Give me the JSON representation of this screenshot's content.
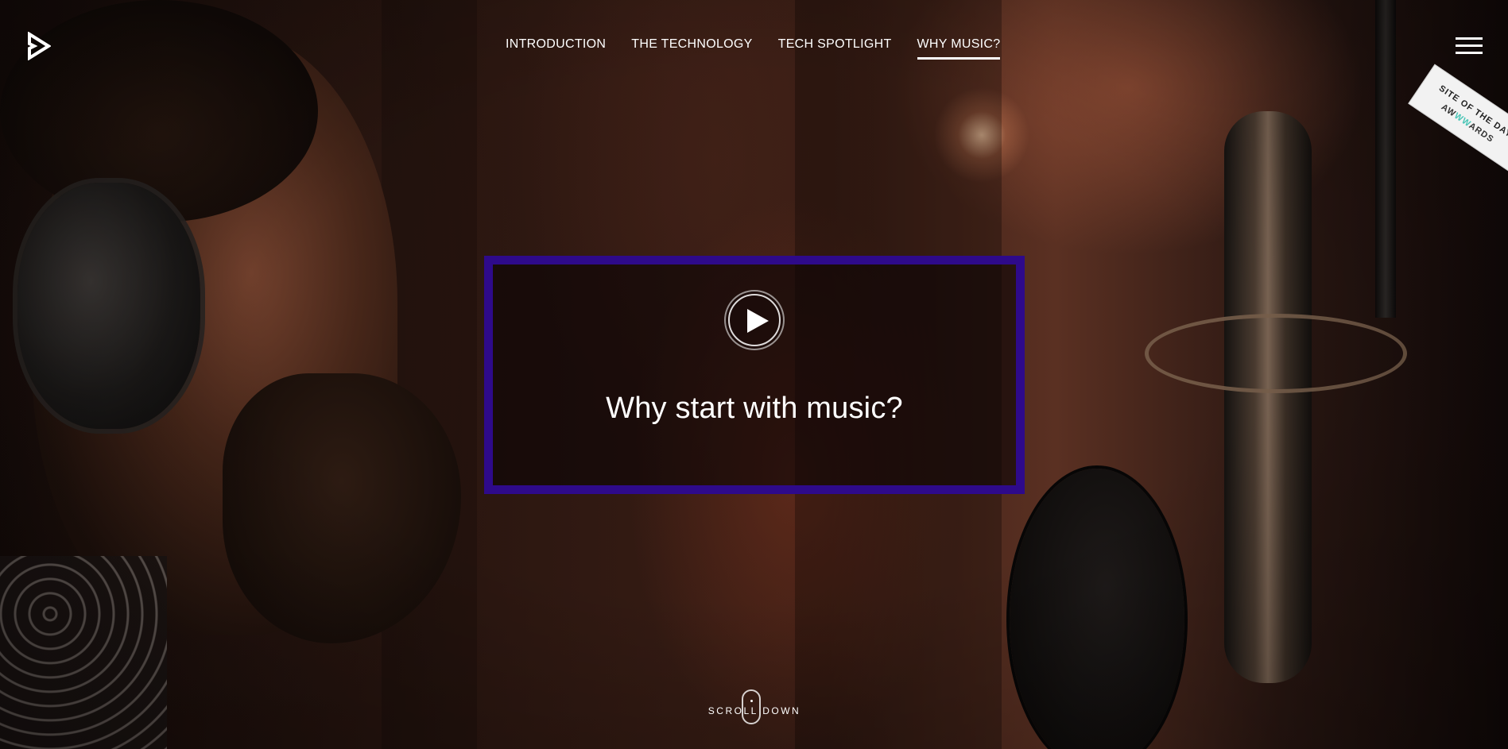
{
  "nav": {
    "items": [
      {
        "label": "INTRODUCTION",
        "active": false
      },
      {
        "label": "THE TECHNOLOGY",
        "active": false
      },
      {
        "label": "TECH SPOTLIGHT",
        "active": false
      },
      {
        "label": "WHY MUSIC?",
        "active": true
      }
    ]
  },
  "hero": {
    "video_title": "Why start with music?",
    "box_border_color": "#2e0a8a"
  },
  "award": {
    "line1": "SITE OF THE DAY",
    "line2_prefix": "AW",
    "line2_accent": "WW",
    "line2_suffix": "ARDS"
  },
  "scroll": {
    "label": "SCROLL DOWN"
  },
  "icons": {
    "logo": "play-triangle-logo-icon",
    "menu": "hamburger-menu-icon",
    "play": "play-icon",
    "scroll": "mouse-scroll-icon"
  }
}
